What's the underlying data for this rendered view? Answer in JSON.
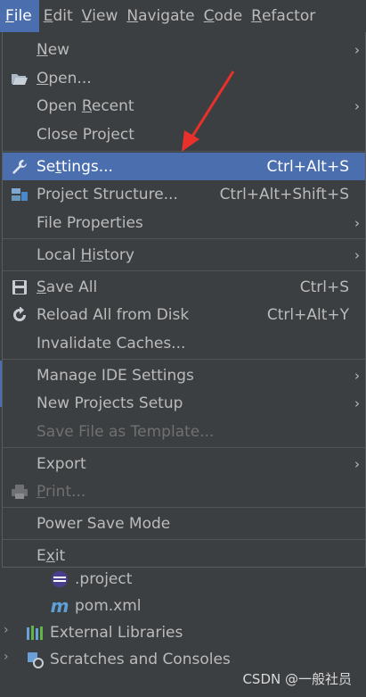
{
  "menubar": {
    "items": [
      {
        "first": "F",
        "rest": "ile"
      },
      {
        "first": "E",
        "rest": "dit"
      },
      {
        "first": "V",
        "rest": "iew"
      },
      {
        "first": "N",
        "rest": "avigate"
      },
      {
        "first": "C",
        "rest": "ode"
      },
      {
        "first": "R",
        "rest": "efactor"
      }
    ]
  },
  "file_menu": {
    "new": {
      "u": "N",
      "rest": "ew"
    },
    "open": {
      "u": "O",
      "rest": "pen..."
    },
    "open_recent": {
      "pre": "Open ",
      "u": "R",
      "rest": "ecent"
    },
    "close_project": "Close Project",
    "settings": {
      "pre": "Se",
      "u": "t",
      "rest": "tings...",
      "shortcut": "Ctrl+Alt+S"
    },
    "project_structure": {
      "label": "Project Structure...",
      "shortcut": "Ctrl+Alt+Shift+S"
    },
    "file_properties": "File Properties",
    "local_history": {
      "pre": "Local ",
      "u": "H",
      "rest": "istory"
    },
    "save_all": {
      "u": "S",
      "rest": "ave All",
      "shortcut": "Ctrl+S"
    },
    "reload": {
      "label": "Reload All from Disk",
      "shortcut": "Ctrl+Alt+Y"
    },
    "invalidate": "Invalidate Caches...",
    "manage_ide": "Manage IDE Settings",
    "new_projects_setup": "New Projects Setup",
    "save_template": "Save File as Template...",
    "export": "Export",
    "print": {
      "u": "P",
      "rest": "rint..."
    },
    "power_save": "Power Save Mode",
    "exit": {
      "pre": "E",
      "u": "x",
      "rest": "it"
    }
  },
  "tree": {
    "project_file": ".project",
    "pom": "pom.xml",
    "external_libraries": "External Libraries",
    "scratches": "Scratches and Consoles"
  },
  "watermark": "CSDN @一般社员",
  "colors": {
    "accent": "#4b6eaf",
    "background": "#3c3f41",
    "arrow": "#e8312a"
  }
}
